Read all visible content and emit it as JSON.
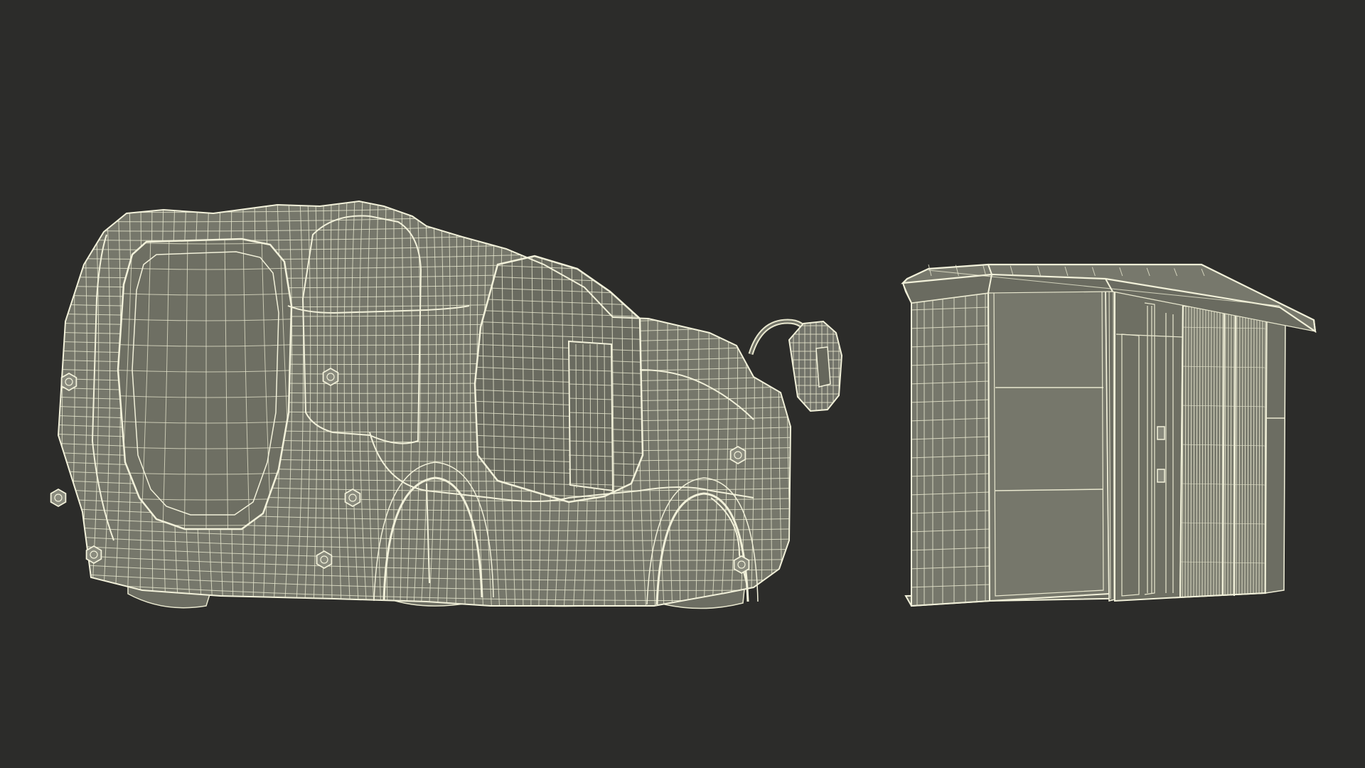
{
  "scene": {
    "background_color": "#2c2c2a",
    "wire_color": "#e9e8cf",
    "surface_color": "#75766a",
    "surface_dark_color": "#66675c",
    "objects": [
      {
        "name": "autonomous-shuttle-bus-wireframe"
      },
      {
        "name": "bus-stop-shelter-kiosk-wireframe"
      }
    ]
  }
}
